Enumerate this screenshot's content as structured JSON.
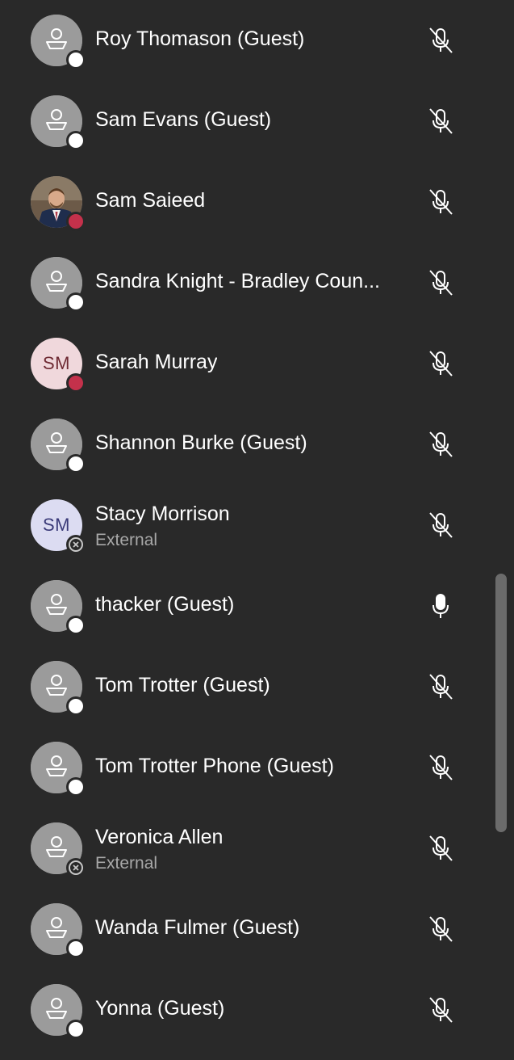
{
  "participants": [
    {
      "name": "Roy Thomason (Guest)",
      "subtitle": "",
      "avatar": "generic",
      "presence": "white",
      "mic": "mic-off-icon"
    },
    {
      "name": "Sam Evans (Guest)",
      "subtitle": "",
      "avatar": "generic",
      "presence": "white",
      "mic": "mic-off-icon"
    },
    {
      "name": "Sam Saieed",
      "subtitle": "",
      "avatar": "photo",
      "presence": "red",
      "mic": "mic-off-icon"
    },
    {
      "name": "Sandra Knight - Bradley Coun...",
      "subtitle": "",
      "avatar": "generic",
      "presence": "white",
      "mic": "mic-off-icon"
    },
    {
      "name": "Sarah Murray",
      "subtitle": "",
      "avatar": "initials",
      "initials": "SM",
      "presence": "red",
      "mic": "mic-off-icon"
    },
    {
      "name": "Shannon Burke (Guest)",
      "subtitle": "",
      "avatar": "generic",
      "presence": "white",
      "mic": "mic-off-icon"
    },
    {
      "name": "Stacy Morrison",
      "subtitle": "External",
      "avatar": "initials",
      "initials": "SM",
      "presence": "external",
      "mic": "mic-off-icon"
    },
    {
      "name": "thacker (Guest)",
      "subtitle": "",
      "avatar": "generic",
      "presence": "white",
      "mic": "mic-on-icon"
    },
    {
      "name": "Tom Trotter (Guest)",
      "subtitle": "",
      "avatar": "generic",
      "presence": "white",
      "mic": "mic-off-icon"
    },
    {
      "name": "Tom Trotter Phone (Guest)",
      "subtitle": "",
      "avatar": "generic",
      "presence": "white",
      "mic": "mic-off-icon"
    },
    {
      "name": "Veronica Allen",
      "subtitle": "External",
      "avatar": "generic",
      "presence": "external",
      "mic": "mic-off-icon"
    },
    {
      "name": "Wanda Fulmer (Guest)",
      "subtitle": "",
      "avatar": "generic",
      "presence": "white",
      "mic": "mic-off-icon"
    },
    {
      "name": "Yonna (Guest)",
      "subtitle": "",
      "avatar": "generic",
      "presence": "white",
      "mic": "mic-off-icon"
    }
  ],
  "colors": {
    "background": "#292929",
    "presence_busy": "#c4314b",
    "presence_available": "#ffffff",
    "avatar_generic": "#9b9b9b",
    "text_primary": "#ffffff",
    "text_secondary": "#a8a8a8"
  }
}
